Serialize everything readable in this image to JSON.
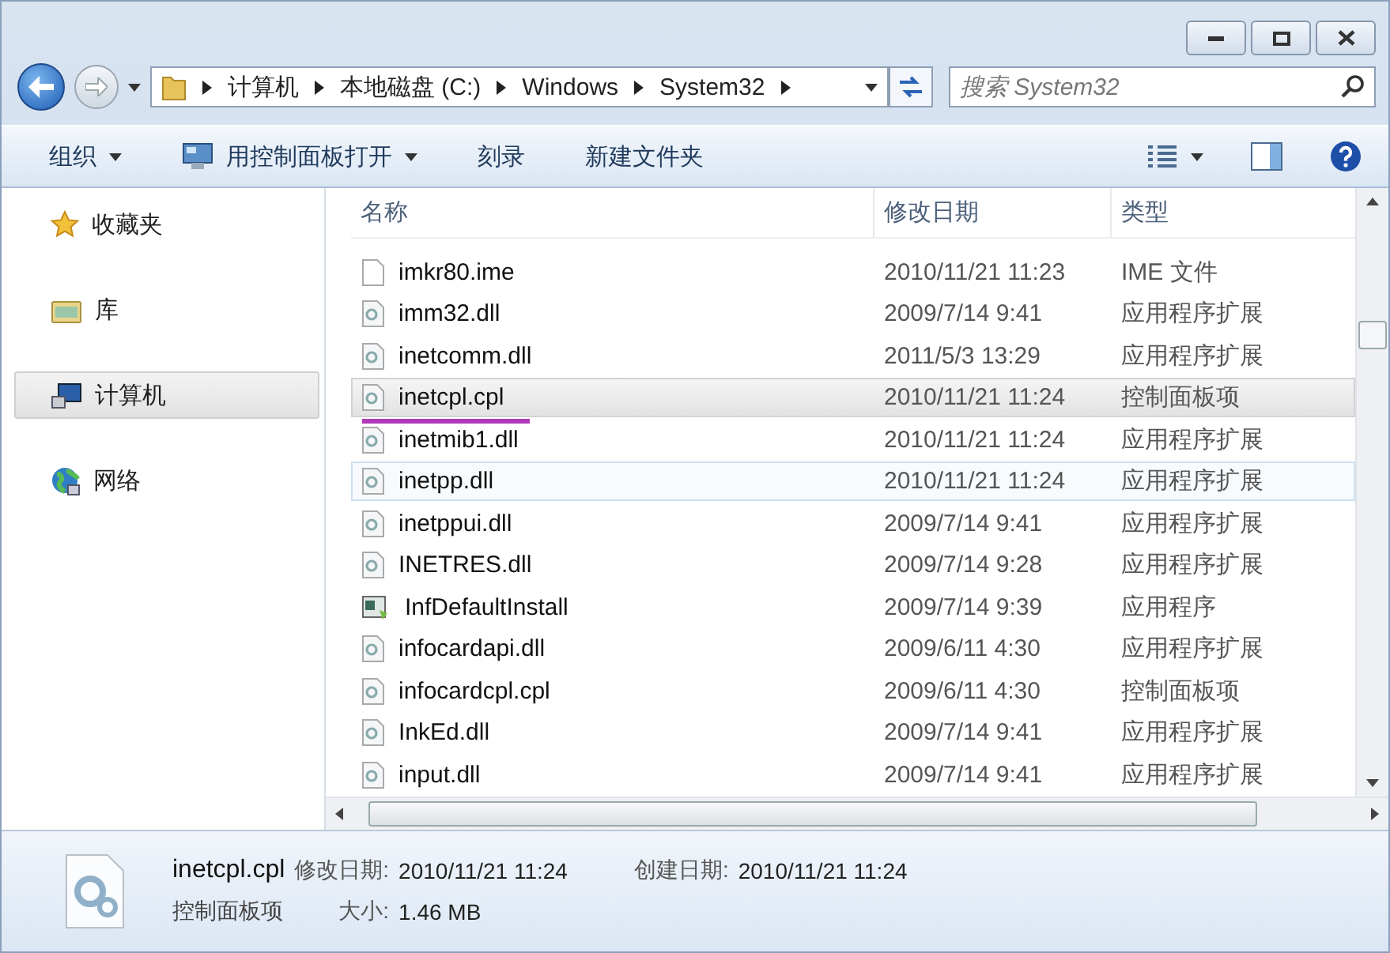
{
  "address_bar": {
    "crumbs": [
      "计算机",
      "本地磁盘 (C:)",
      "Windows",
      "System32"
    ]
  },
  "search": {
    "placeholder": "搜索 System32"
  },
  "toolbar": {
    "items": [
      {
        "label": "组织",
        "dropdown": true,
        "icon": false
      },
      {
        "label": "用控制面板打开",
        "dropdown": true,
        "icon": true
      },
      {
        "label": "刻录",
        "dropdown": false,
        "icon": false
      },
      {
        "label": "新建文件夹",
        "dropdown": false,
        "icon": false
      }
    ]
  },
  "sidebar": {
    "items": [
      {
        "label": "收藏夹",
        "kind": "favorites",
        "selected": false
      },
      {
        "label": "库",
        "kind": "library",
        "selected": false
      },
      {
        "label": "计算机",
        "kind": "computer",
        "selected": true
      },
      {
        "label": "网络",
        "kind": "network",
        "selected": false
      }
    ]
  },
  "table": {
    "columns": [
      "名称",
      "修改日期",
      "类型"
    ],
    "rows": [
      {
        "name": "imkr80.ime",
        "date": "2010/11/21 11:23",
        "type": "IME 文件",
        "kind": "blank",
        "selected": false,
        "hovered": false,
        "underlined": false
      },
      {
        "name": "imm32.dll",
        "date": "2009/7/14 9:41",
        "type": "应用程序扩展",
        "kind": "dll",
        "selected": false,
        "hovered": false,
        "underlined": false
      },
      {
        "name": "inetcomm.dll",
        "date": "2011/5/3 13:29",
        "type": "应用程序扩展",
        "kind": "dll",
        "selected": false,
        "hovered": false,
        "underlined": false
      },
      {
        "name": "inetcpl.cpl",
        "date": "2010/11/21 11:24",
        "type": "控制面板项",
        "kind": "dll",
        "selected": true,
        "hovered": false,
        "underlined": true
      },
      {
        "name": "inetmib1.dll",
        "date": "2010/11/21 11:24",
        "type": "应用程序扩展",
        "kind": "dll",
        "selected": false,
        "hovered": false,
        "underlined": false
      },
      {
        "name": "inetpp.dll",
        "date": "2010/11/21 11:24",
        "type": "应用程序扩展",
        "kind": "dll",
        "selected": false,
        "hovered": true,
        "underlined": false
      },
      {
        "name": "inetppui.dll",
        "date": "2009/7/14 9:41",
        "type": "应用程序扩展",
        "kind": "dll",
        "selected": false,
        "hovered": false,
        "underlined": false
      },
      {
        "name": "INETRES.dll",
        "date": "2009/7/14 9:28",
        "type": "应用程序扩展",
        "kind": "dll",
        "selected": false,
        "hovered": false,
        "underlined": false
      },
      {
        "name": "InfDefaultInstall",
        "date": "2009/7/14 9:39",
        "type": "应用程序",
        "kind": "exe",
        "selected": false,
        "hovered": false,
        "underlined": false
      },
      {
        "name": "infocardapi.dll",
        "date": "2009/6/11 4:30",
        "type": "应用程序扩展",
        "kind": "dll",
        "selected": false,
        "hovered": false,
        "underlined": false
      },
      {
        "name": "infocardcpl.cpl",
        "date": "2009/6/11 4:30",
        "type": "控制面板项",
        "kind": "dll",
        "selected": false,
        "hovered": false,
        "underlined": false
      },
      {
        "name": "InkEd.dll",
        "date": "2009/7/14 9:41",
        "type": "应用程序扩展",
        "kind": "dll",
        "selected": false,
        "hovered": false,
        "underlined": false
      },
      {
        "name": "input.dll",
        "date": "2009/7/14 9:41",
        "type": "应用程序扩展",
        "kind": "dll",
        "selected": false,
        "hovered": false,
        "underlined": false
      }
    ]
  },
  "details": {
    "name": "inetcpl.cpl",
    "type": "控制面板项",
    "modified_label": "修改日期:",
    "modified": "2010/11/21 11:24",
    "created_label": "创建日期:",
    "created": "2010/11/21 11:24",
    "size_label": "大小:",
    "size": "1.46 MB"
  }
}
